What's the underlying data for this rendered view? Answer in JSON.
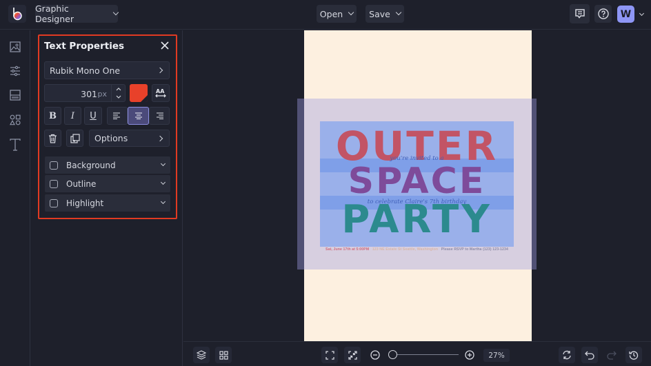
{
  "topbar": {
    "app_menu_label": "Graphic Designer",
    "open_label": "Open",
    "save_label": "Save",
    "avatar_letter": "W",
    "avatar_color": "#8e96f5",
    "icons": [
      "logo-icon",
      "comment-icon",
      "help-icon"
    ]
  },
  "leftrail": {
    "items": [
      {
        "name": "image",
        "icon": "image-icon"
      },
      {
        "name": "adjustments",
        "icon": "sliders-icon"
      },
      {
        "name": "layout",
        "icon": "layout-icon"
      },
      {
        "name": "graphics",
        "icon": "shapes-icon"
      },
      {
        "name": "text",
        "icon": "text-icon"
      }
    ]
  },
  "text_properties": {
    "title": "Text Properties",
    "font": "Rubik Mono One",
    "size_value": "301",
    "size_unit": "px",
    "color": "#e8412a",
    "style_buttons": [
      "B",
      "I",
      "U"
    ],
    "alignment": "center",
    "options_label": "Options",
    "toggles": [
      {
        "label": "Background",
        "checked": false
      },
      {
        "label": "Outline",
        "checked": false
      },
      {
        "label": "Highlight",
        "checked": false
      }
    ],
    "highlight_color": "#e23a22"
  },
  "artwork": {
    "line1": "OUTER",
    "line2": "SPACE",
    "line3": "PARTY",
    "script1": "you're invited to a",
    "script2": "to celebrate Claire's 7th birthday",
    "footer_date": "Sat, June 17th at 5:00PM",
    "footer_address": "123 NE Estate St Seattle, Washington",
    "footer_rsvp": "Please RSVP to Martha (123) 123-1234",
    "colors": {
      "line1": "#c25465",
      "line2": "#7e4b9a",
      "line3": "#2c8a8e",
      "background": "#9ab0ea",
      "page": "#fdf0e0"
    }
  },
  "bottombar": {
    "zoom_percent": "27%",
    "zoom_fraction": 0.0
  }
}
